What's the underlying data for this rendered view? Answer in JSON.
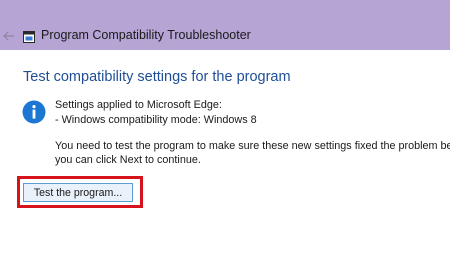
{
  "window": {
    "title": "Program Compatibility Troubleshooter",
    "back_icon": "back-arrow-icon",
    "app_icon": "troubleshooter-icon"
  },
  "page": {
    "heading": "Test compatibility settings for the program",
    "info_icon": "info-icon",
    "settings_applied": "Settings applied to Microsoft Edge:",
    "compatibility_mode": "- Windows compatibility mode: Windows 8",
    "note_line1": "You need to test the program to make sure these new settings fixed the problem before",
    "note_line2": "you can click Next to continue.",
    "test_button_label": "Test the program..."
  },
  "colors": {
    "titlebar": "#b6a4d5",
    "heading": "#1e4f96",
    "info_icon": "#1c77d2",
    "highlight": "#d6121c",
    "button_border": "#5d9ad8",
    "button_fill": "#e9f1fb"
  }
}
